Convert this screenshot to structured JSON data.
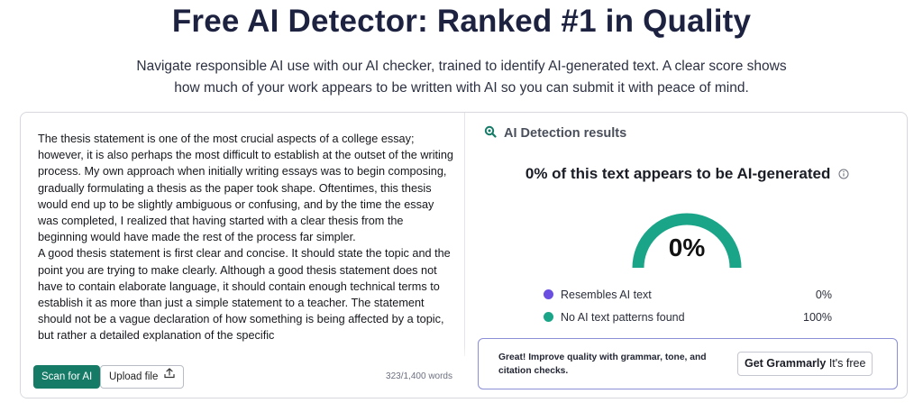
{
  "header": {
    "title": "Free AI Detector: Ranked #1 in Quality",
    "subtitle": "Navigate responsible AI use with our AI checker, trained to identify AI-generated text. A clear score shows how much of your work appears to be written with AI so you can submit it with peace of mind."
  },
  "editor": {
    "paragraphs": [
      "The thesis statement is one of the most crucial aspects of a college essay; however, it is also perhaps the most difficult to establish at the outset of the writing process. My own approach when initially writing essays was to begin composing, gradually formulating a thesis as the paper took shape. Oftentimes, this thesis would end up to be slightly ambiguous or confusing, and by the time the essay was completed, I realized that having started with a clear thesis from the beginning would have made the rest of the process far simpler.",
      "A good thesis statement is first clear and concise. It should state the topic and the point you are trying to make clearly. Although a good thesis statement does not have to contain elaborate language, it should contain enough technical terms to establish it as more than just a simple statement to a teacher. The statement should not be a vague declaration of how something is being affected by a topic, but rather a detailed explanation of the specific"
    ],
    "scan_label": "Scan for AI",
    "upload_label": "Upload file",
    "word_count": "323/1,400 words"
  },
  "results": {
    "header_label": "AI Detection results",
    "headline": "0% of this text appears to be AI-generated",
    "score_text": "0%",
    "score_fraction": 0,
    "gauge_color": "#1aa589",
    "legend": [
      {
        "label": "Resembles AI text",
        "value": "0%",
        "color": "#6b4fe0"
      },
      {
        "label": "No AI text patterns found",
        "value": "100%",
        "color": "#1aa589"
      }
    ],
    "promo": {
      "text": "Great! Improve quality with grammar, tone, and citation checks.",
      "button_strong": "Get Grammarly",
      "button_rest": "It's free"
    }
  }
}
